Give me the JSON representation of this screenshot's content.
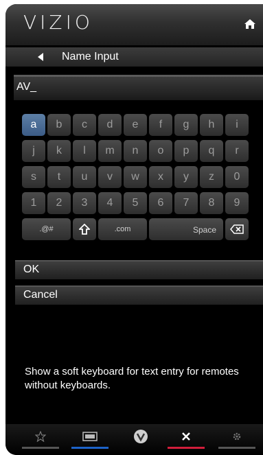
{
  "header": {
    "logo": "VIZIO",
    "home_icon": "home-icon"
  },
  "nav": {
    "title": "Name Input",
    "back_icon": "back-arrow-icon"
  },
  "input": {
    "value": "AV_"
  },
  "keyboard": {
    "rows": [
      [
        "a",
        "b",
        "c",
        "d",
        "e",
        "f",
        "g",
        "h",
        "i"
      ],
      [
        "j",
        "k",
        "l",
        "m",
        "n",
        "o",
        "p",
        "q",
        "r"
      ],
      [
        "s",
        "t",
        "u",
        "v",
        "w",
        "x",
        "y",
        "z",
        "0"
      ],
      [
        "1",
        "2",
        "3",
        "4",
        "5",
        "6",
        "7",
        "8",
        "9"
      ]
    ],
    "selected_key": "a",
    "special": {
      "symbols": ".@#",
      "shift_icon": "shift-icon",
      "dotcom": ".com",
      "space": "Space",
      "backspace_icon": "backspace-icon"
    }
  },
  "menu": {
    "ok": "OK",
    "cancel": "Cancel"
  },
  "description": "Show a soft keyboard for text entry for remotes without keyboards.",
  "bottom_bar": {
    "items": [
      {
        "icon": "star-icon",
        "color": "#555555"
      },
      {
        "icon": "input-icon",
        "color": "#1d63c9"
      },
      {
        "icon": "vizio-v-icon",
        "color": "#000000"
      },
      {
        "icon": "close-icon",
        "color": "#d11e3b"
      },
      {
        "icon": "gear-icon",
        "color": "#555555"
      }
    ]
  }
}
